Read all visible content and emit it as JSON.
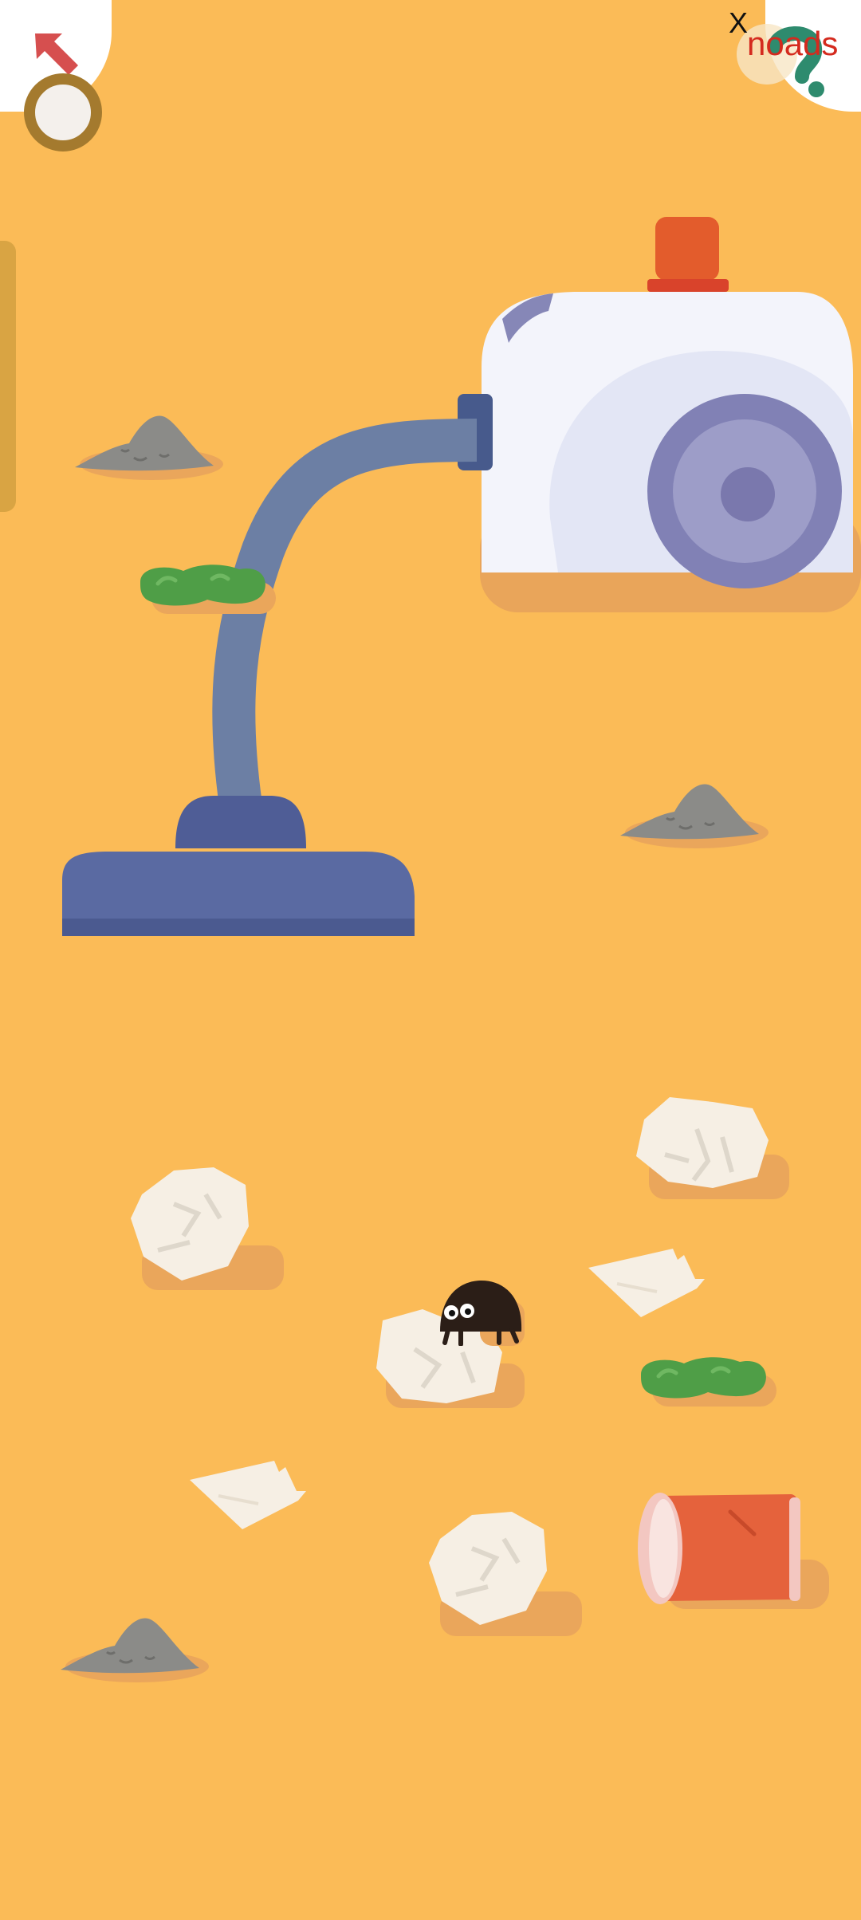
{
  "top_bar": {
    "back_icon": "back-arrow-icon",
    "home_icon": "home-ring-icon",
    "help_icon": "question-mark-icon",
    "noads_close": "X",
    "noads_label": "noads"
  },
  "scene": {
    "theme": "vacuum-cleaning-game",
    "background_color": "#FBBB57",
    "items": [
      "vacuum-cleaner",
      "vacuum-hose",
      "vacuum-nozzle",
      "dust-pile",
      "green-goo",
      "crumpled-paper",
      "paper-scrap",
      "red-cup",
      "dust-bunny-character"
    ]
  },
  "colors": {
    "back_arrow": "#D64F4F",
    "help": "#2E8B6E",
    "vacuum_body": "#F3F4FB",
    "vacuum_wheel": "#8E8BBE",
    "vacuum_hose": "#6C7FA4",
    "vacuum_nozzle": "#56659C",
    "vacuum_top": "#E35C2C",
    "dust": "#8B8B88",
    "goo": "#4F9E47",
    "paper": "#F6EFE4",
    "cup": "#E5623C"
  }
}
